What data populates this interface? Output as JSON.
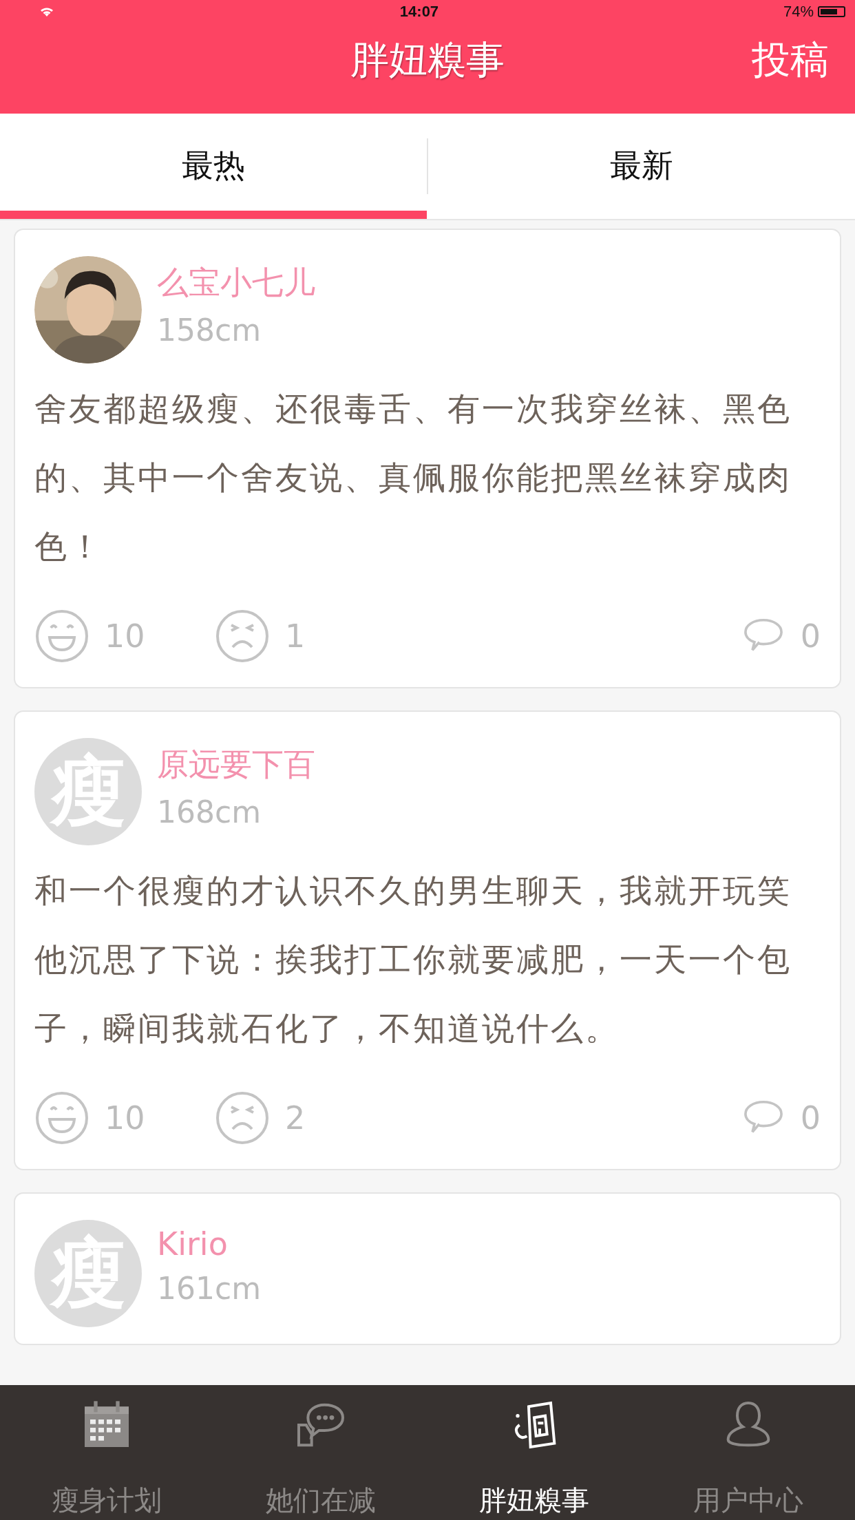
{
  "status_bar": {
    "time": "14:07",
    "battery": "74%"
  },
  "header": {
    "title": "胖妞糗事",
    "action": "投稿"
  },
  "tabs": [
    {
      "label": "最热",
      "selected": true
    },
    {
      "label": "最新",
      "selected": false
    }
  ],
  "posts": [
    {
      "name": "么宝小七儿",
      "height": "158cm",
      "text": "舍友都超级瘦、还很毒舌、有一次我穿丝袜、黑色的、其中一个舍友说、真佩服你能把黑丝袜穿成肉色！",
      "likes": "10",
      "dislikes": "1",
      "comments": "0"
    },
    {
      "avatar": {
        "kind": "default",
        "glyph": "瘦"
      },
      "name": "原远要下百",
      "height": "168cm",
      "text": "和一个很瘦的才认识不久的男生聊天，我就开玩笑他沉思了下说：挨我打工你就要减肥，一天一个包子，瞬间我就石化了，不知道说什么。",
      "likes": "10",
      "dislikes": "2",
      "comments": "0"
    },
    {
      "avatar": {
        "kind": "default",
        "glyph": "瘦"
      },
      "name": "Kirio",
      "height": "161cm"
    }
  ],
  "bottom_nav": [
    {
      "label": "瘦身计划",
      "selected": false
    },
    {
      "label": "她们在减",
      "selected": false
    },
    {
      "label": "胖妞糗事",
      "selected": true
    },
    {
      "label": "用户中心",
      "selected": false
    }
  ]
}
